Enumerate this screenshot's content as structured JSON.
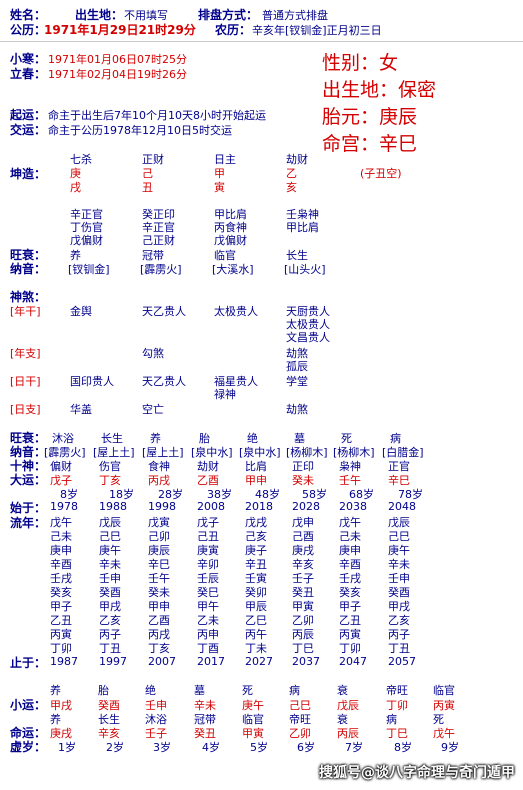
{
  "header": {
    "name_label": "姓名：",
    "birthplace_label": "出生地：",
    "birthplace_value": "不用填写",
    "method_label": "排盘方式：",
    "method_value": "普通方式排盘",
    "solar_label": "公历：",
    "solar_value": "1971年1月29日21时29分",
    "lunar_label": "农历：",
    "lunar_value": "辛亥年[钗钏金]正月初三日"
  },
  "jieqi": {
    "xiaohan_label": "小寒：",
    "xiaohan_value": "1971年01月06日07时25分",
    "lichun_label": "立春：",
    "lichun_value": "1971年02月04日19时26分"
  },
  "summary": {
    "gender": "性别：女",
    "birthplace": "出生地：保密",
    "taiyuan": "胎元：庚辰",
    "minggong": "命宫：辛巳"
  },
  "qiyun": {
    "qiyun_label": "起运：",
    "qiyun_value": "命主于出生后7年10个月10天8小时开始起运",
    "jiaoyun_label": "交运：",
    "jiaoyun_value": "命主于公历1978年12月10日5时交运"
  },
  "pillars": {
    "label": "坤造：",
    "shishen": [
      "七杀",
      "正财",
      "日主",
      "劫财"
    ],
    "gan": [
      "庚",
      "己",
      "甲",
      "乙"
    ],
    "zhi": [
      "戌",
      "丑",
      "寅",
      "亥"
    ],
    "kong": "(子丑空)",
    "canggan": [
      [
        "辛正官",
        "丁伤官",
        "戊偏财"
      ],
      [
        "癸正印",
        "辛正官",
        "己正财"
      ],
      [
        "甲比肩",
        "丙食神",
        "戊偏财"
      ],
      [
        "壬枭神",
        "甲比肩",
        ""
      ]
    ],
    "wangshuai_label": "旺衰：",
    "wangshuai": [
      "养",
      "冠带",
      "临官",
      "长生"
    ],
    "nayin_label": "纳音：",
    "nayin": [
      "[钗钏金]",
      "[霹雳火]",
      "[大溪水]",
      "[山头火]"
    ]
  },
  "shensha": {
    "title": "神煞：",
    "rows": [
      {
        "label": "[年干]",
        "cols": [
          [
            "金舆"
          ],
          [
            "天乙贵人"
          ],
          [
            "太极贵人"
          ],
          [
            "天厨贵人",
            "太极贵人",
            "文昌贵人"
          ]
        ]
      },
      {
        "label": "[年支]",
        "cols": [
          [
            ""
          ],
          [
            "勾煞"
          ],
          [
            ""
          ],
          [
            "劫煞",
            "孤辰"
          ]
        ]
      },
      {
        "label": "[日干]",
        "cols": [
          [
            "国印贵人"
          ],
          [
            "天乙贵人"
          ],
          [
            "福星贵人",
            "禄神"
          ],
          [
            "学堂"
          ]
        ]
      },
      {
        "label": "[日支]",
        "cols": [
          [
            "华盖"
          ],
          [
            "空亡"
          ],
          [
            ""
          ],
          [
            "劫煞"
          ]
        ]
      }
    ]
  },
  "dayun": {
    "wangshuai_label": "旺衰：",
    "wangshuai": [
      "沐浴",
      "长生",
      "养",
      "胎",
      "绝",
      "墓",
      "死",
      "病"
    ],
    "nayin_label": "纳音：",
    "nayin": [
      "[霹雳火]",
      "[屋上土]",
      "[屋上土]",
      "[泉中水]",
      "[泉中水]",
      "[杨柳木]",
      "[杨柳木]",
      "[白腊金]"
    ],
    "shishen_label": "十神：",
    "shishen": [
      "偏财",
      "伤官",
      "食神",
      "劫财",
      "比肩",
      "正印",
      "枭神",
      "正官"
    ],
    "dayun_label": "大运：",
    "dayun": [
      "戊子",
      "丁亥",
      "丙戌",
      "乙酉",
      "甲申",
      "癸未",
      "壬午",
      "辛巳"
    ],
    "age": [
      "8岁",
      "18岁",
      "28岁",
      "38岁",
      "48岁",
      "58岁",
      "68岁",
      "78岁"
    ],
    "start_label": "始于：",
    "start": [
      "1978",
      "1988",
      "1998",
      "2008",
      "2018",
      "2028",
      "2038",
      "2048"
    ],
    "liunian_label": "流年：",
    "liunian": [
      [
        "戊午",
        "己未",
        "庚申",
        "辛酉",
        "壬戌",
        "癸亥",
        "甲子",
        "乙丑",
        "丙寅",
        "丁卯"
      ],
      [
        "戊辰",
        "己巳",
        "庚午",
        "辛未",
        "壬申",
        "癸酉",
        "甲戌",
        "乙亥",
        "丙子",
        "丁丑"
      ],
      [
        "戊寅",
        "己卯",
        "庚辰",
        "辛巳",
        "壬午",
        "癸未",
        "甲申",
        "乙酉",
        "丙戌",
        "丁亥"
      ],
      [
        "戊子",
        "己丑",
        "庚寅",
        "辛卯",
        "壬辰",
        "癸巳",
        "甲午",
        "乙未",
        "丙申",
        "丁酉"
      ],
      [
        "戊戌",
        "己亥",
        "庚子",
        "辛丑",
        "壬寅",
        "癸卯",
        "甲辰",
        "乙巳",
        "丙午",
        "丁未"
      ],
      [
        "戊申",
        "己酉",
        "庚戌",
        "辛亥",
        "壬子",
        "癸丑",
        "甲寅",
        "乙卯",
        "丙辰",
        "丁巳"
      ],
      [
        "戊午",
        "己未",
        "庚申",
        "辛酉",
        "壬戌",
        "癸亥",
        "甲子",
        "乙丑",
        "丙寅",
        "丁卯"
      ],
      [
        "戊辰",
        "己巳",
        "庚午",
        "辛未",
        "壬申",
        "癸酉",
        "甲戌",
        "乙亥",
        "丙子",
        "丁丑"
      ]
    ],
    "end_label": "止于：",
    "end": [
      "1987",
      "1997",
      "2007",
      "2017",
      "2027",
      "2037",
      "2047",
      "2057"
    ]
  },
  "xiaoyun": {
    "top_ws": [
      "养",
      "胎",
      "绝",
      "墓",
      "死",
      "病",
      "衰",
      "帝旺",
      "临官"
    ],
    "label": "小运：",
    "values": [
      "甲戌",
      "癸酉",
      "壬申",
      "辛未",
      "庚午",
      "己巳",
      "戊辰",
      "丁卯",
      "丙寅"
    ],
    "bot_ws": [
      "养",
      "长生",
      "沐浴",
      "冠带",
      "临官",
      "帝旺",
      "衰",
      "病",
      "死"
    ],
    "mingyun_label": "命运：",
    "mingyun": [
      "庚戌",
      "辛亥",
      "壬子",
      "癸丑",
      "甲寅",
      "乙卯",
      "丙辰",
      "丁巳",
      "戊午"
    ],
    "xusui_label": "虚岁：",
    "xusui": [
      "1岁",
      "2岁",
      "3岁",
      "4岁",
      "5岁",
      "6岁",
      "7岁",
      "8岁",
      "9岁"
    ]
  },
  "watermark": "搜狐号@谈八字命理与奇门遁甲",
  "colors": {
    "label": "#00008b",
    "highlight": "#d40000"
  }
}
